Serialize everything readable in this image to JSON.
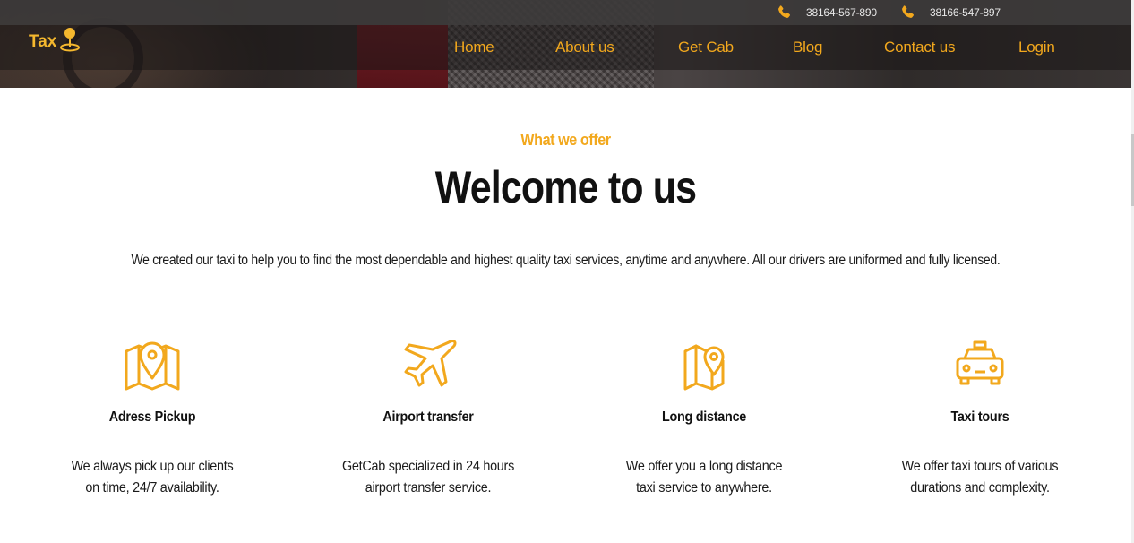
{
  "header": {
    "phones": [
      "38164-567-890",
      "38166-547-897"
    ],
    "logo_text": "Tax",
    "nav": [
      "Home",
      "About us",
      "Get Cab",
      "Blog",
      "Contact us",
      "Login"
    ]
  },
  "hero": {
    "eyebrow": "What we offer",
    "title": "Welcome to us",
    "intro": "We created our taxi to help you to find the most dependable and highest quality taxi services, anytime and anywhere. All our drivers are uniformed and fully licensed."
  },
  "services": [
    {
      "icon": "map-pin-icon",
      "title": "Adress Pickup",
      "text": "We always pick up our clients on time, 24/7 availability."
    },
    {
      "icon": "airplane-icon",
      "title": "Airport transfer",
      "text": "GetCab specialized in 24 hours airport transfer service."
    },
    {
      "icon": "map-location-icon",
      "title": "Long distance",
      "text": "We offer you a long distance taxi service to anywhere."
    },
    {
      "icon": "taxi-car-icon",
      "title": "Taxi tours",
      "text": "We offer taxi tours of various durations and complexity."
    }
  ],
  "colors": {
    "accent": "#f2a81d",
    "text": "#111111"
  }
}
